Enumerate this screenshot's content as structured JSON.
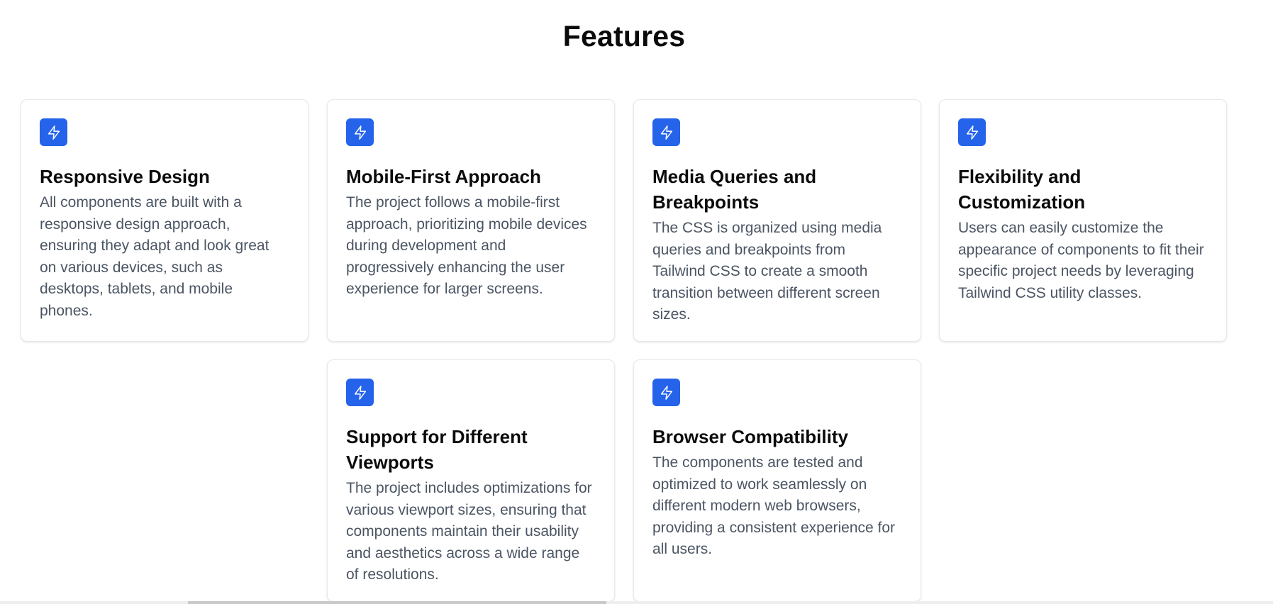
{
  "page": {
    "title": "Features"
  },
  "colors": {
    "icon_bg": "#2563eb",
    "title_text": "#0b0b0b",
    "body_text": "#4b5563"
  },
  "features": [
    {
      "icon": "lightning-bolt-icon",
      "title": "Responsive Design",
      "description": "All components are built with a responsive design approach, ensuring they adapt and look great on various devices, such as desktops, tablets, and mobile phones."
    },
    {
      "icon": "lightning-bolt-icon",
      "title": "Mobile-First Approach",
      "description": "The project follows a mobile-first approach, prioritizing mobile devices during development and progressively enhancing the user experience for larger screens."
    },
    {
      "icon": "lightning-bolt-icon",
      "title": "Media Queries and Breakpoints",
      "description": "The CSS is organized using media queries and breakpoints from Tailwind CSS to create a smooth transition between different screen sizes."
    },
    {
      "icon": "lightning-bolt-icon",
      "title": "Flexibility and Customization",
      "description": "Users can easily customize the appearance of components to fit their specific project needs by leveraging Tailwind CSS utility classes."
    },
    {
      "icon": "lightning-bolt-icon",
      "title": "Support for Different Viewports",
      "description": "The project includes optimizations for various viewport sizes, ensuring that components maintain their usability and aesthetics across a wide range of resolutions."
    },
    {
      "icon": "lightning-bolt-icon",
      "title": "Browser Compatibility",
      "description": "The components are tested and optimized to work seamlessly on different modern web browsers, providing a consistent experience for all users."
    }
  ]
}
